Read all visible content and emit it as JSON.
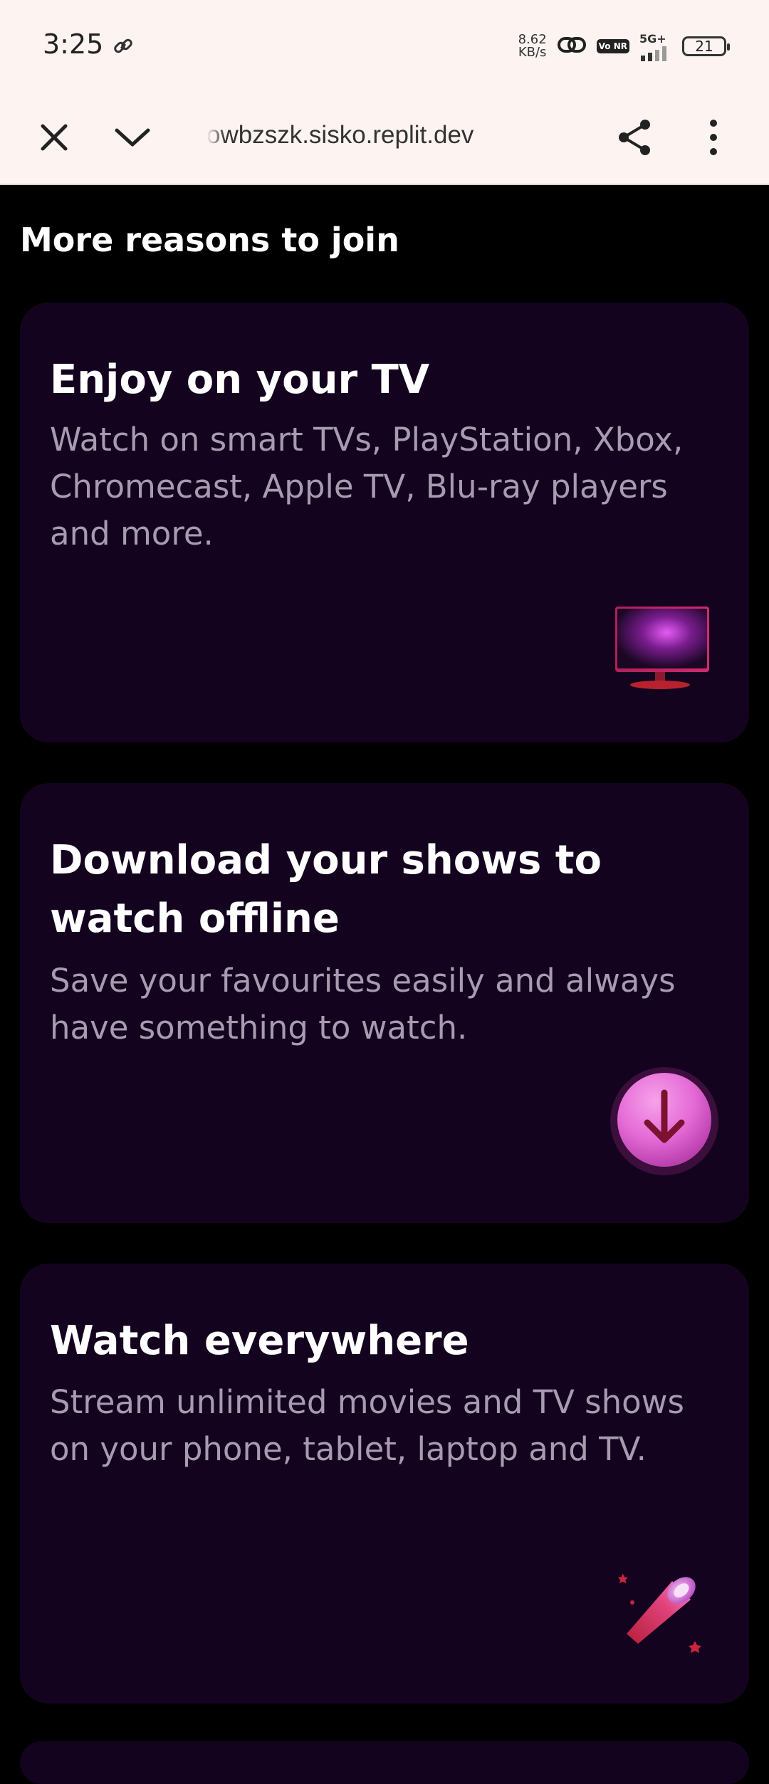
{
  "status_bar": {
    "time": "3:25",
    "net_speed_value": "8.62",
    "net_speed_unit": "KB/s",
    "volte_badge": "Vo NR",
    "network": "5G+",
    "battery": "21"
  },
  "browser": {
    "url": "owbzszk.sisko.replit.dev"
  },
  "page": {
    "section_title": "More reasons to join",
    "cards": [
      {
        "title": "Enjoy on your TV",
        "description": "Watch on smart TVs, PlayStation, Xbox, Chromecast, Apple TV, Blu-ray players and more.",
        "icon": "tv-icon"
      },
      {
        "title": "Download your shows to watch offline",
        "description": "Save your favourites easily and always have something to watch.",
        "icon": "download-icon"
      },
      {
        "title": "Watch everywhere",
        "description": "Stream unlimited movies and TV shows on your phone, tablet, laptop and TV.",
        "icon": "telescope-icon"
      }
    ]
  },
  "colors": {
    "page_bg": "#000000",
    "card_bg": "#14031f",
    "text_primary": "#ffffff",
    "text_secondary": "#a79bb0",
    "chrome_bg": "#fdf4f2"
  }
}
